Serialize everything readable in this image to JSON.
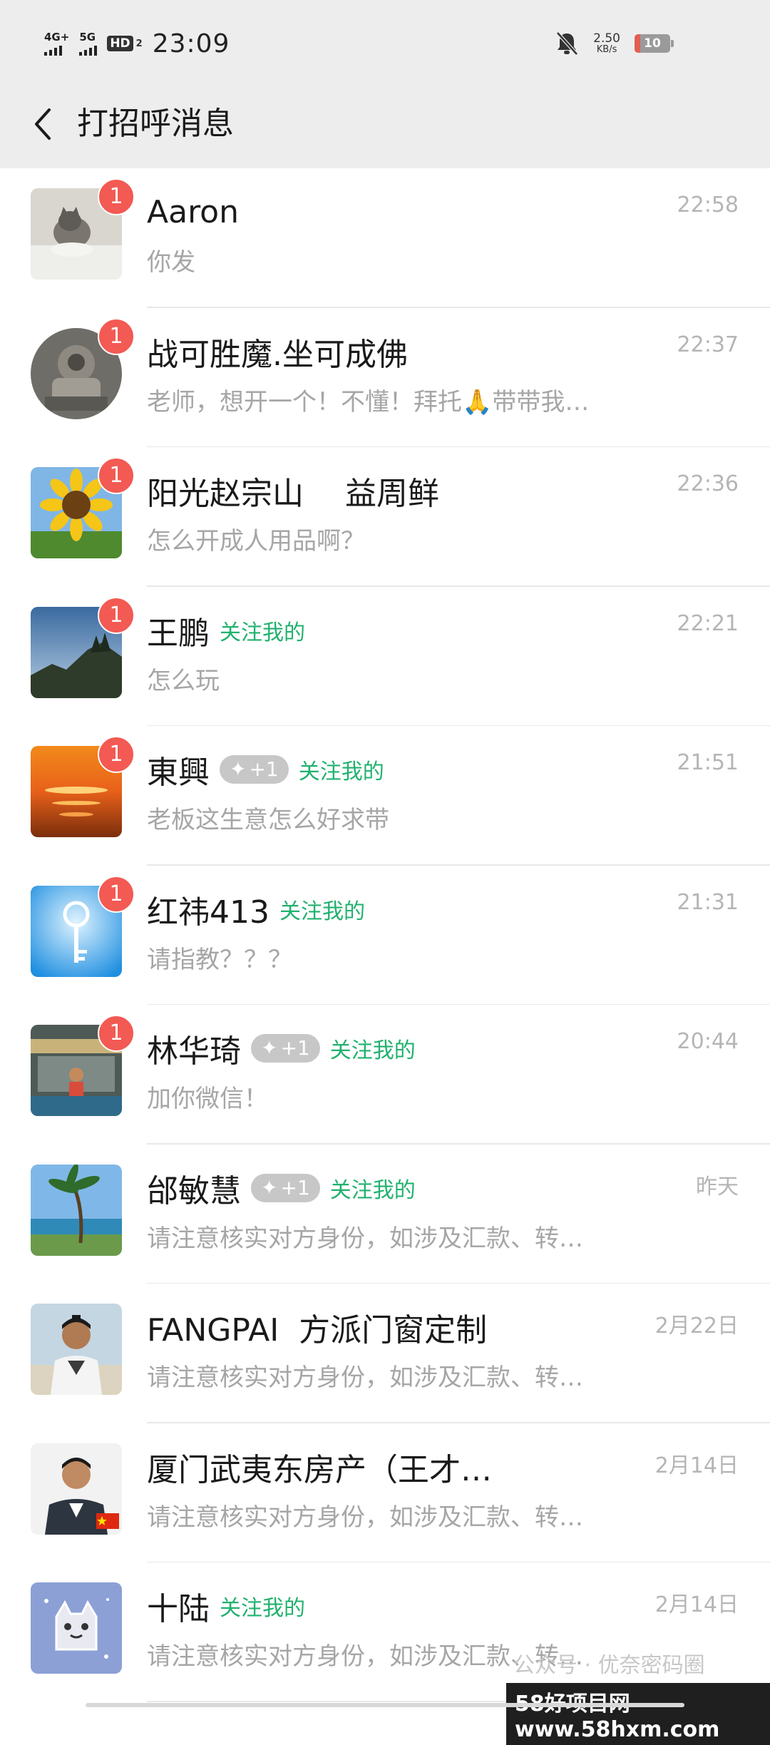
{
  "status_bar": {
    "net1": "4G+",
    "net2": "5G",
    "hd": "HD",
    "hd_sub": "2",
    "time": "23:09",
    "speed_value": "2.50",
    "speed_unit": "KB/s",
    "battery": "10"
  },
  "header": {
    "title": "打招呼消息"
  },
  "messages": [
    {
      "name": "Aaron",
      "preview": "你发",
      "time": "22:58",
      "unread": "1"
    },
    {
      "name": "战可胜魔.坐可成佛",
      "preview": "老师，想开一个！不懂！拜托🙏带带我…",
      "time": "22:37",
      "unread": "1"
    },
    {
      "name": "阳光赵宗山　 益周鲜",
      "preview": "怎么开成人用品啊？",
      "time": "22:36",
      "unread": "1"
    },
    {
      "name": "王鹏",
      "follow": "关注我的",
      "preview": "怎么玩",
      "time": "22:21",
      "unread": "1"
    },
    {
      "name": "東興",
      "pill": "+1",
      "follow": "关注我的",
      "preview": "老板这生意怎么好求带",
      "time": "21:51",
      "unread": "1"
    },
    {
      "name": "红祎413",
      "follow": "关注我的",
      "preview": "请指教？？？",
      "time": "21:31",
      "unread": "1"
    },
    {
      "name": "林华琦",
      "pill": "+1",
      "follow": "关注我的",
      "preview": "加你微信！",
      "time": "20:44",
      "unread": "1"
    },
    {
      "name": "邰敏慧",
      "pill": "+1",
      "follow": "关注我的",
      "preview": "请注意核实对方身份，如涉及汇款、转…",
      "time": "昨天"
    },
    {
      "name": "FANGPAI  方派门窗定制",
      "preview": "请注意核实对方身份，如涉及汇款、转…",
      "time": "2月22日"
    },
    {
      "name": "厦门武夷东房产（王才…",
      "preview": "请注意核实对方身份，如涉及汇款、转…",
      "time": "2月14日"
    },
    {
      "name": "十陆",
      "follow": "关注我的",
      "preview": "请注意核实对方身份，如涉及汇款、转…",
      "time": "2月14日"
    }
  ],
  "watermark": "公众号 · 优奈密码圈",
  "site_mark": "58好项目网www.58hxm.com",
  "colors": {
    "header_bg": "#ededed",
    "unread_badge": "#f25a53",
    "follow_green": "#21b16e",
    "pill_grey": "#c7c7c7"
  }
}
